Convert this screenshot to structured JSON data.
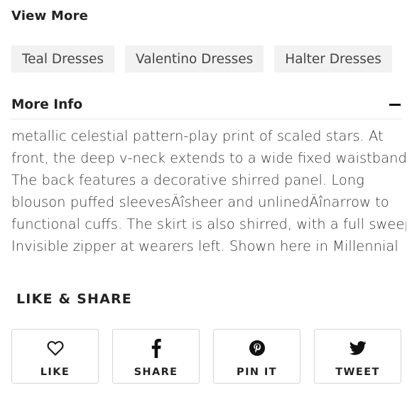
{
  "view_more": {
    "title": "View More",
    "tags": [
      "Teal Dresses",
      "Valentino Dresses",
      "Halter Dresses"
    ]
  },
  "more_info": {
    "title": "More Info",
    "lines": [
      "metallic celestial pattern-play print of scaled stars. At",
      "front, the deep v-neck extends to a wide fixed waistband.",
      "The back features a decorative shirred panel. Long",
      "blouson puffed sleevesÄîsheer and unlinedÄînarrow to",
      "functional cuffs. The skirt is also shirred, with a full sweep.",
      "Invisible zipper at wearers left. Shown here in Millennial"
    ]
  },
  "like_share": {
    "title": "LIKE & SHARE",
    "buttons": [
      {
        "label": "LIKE",
        "icon": "heart-icon"
      },
      {
        "label": "SHARE",
        "icon": "facebook-icon"
      },
      {
        "label": "PIN IT",
        "icon": "pinterest-icon"
      },
      {
        "label": "TWEET",
        "icon": "twitter-icon"
      }
    ]
  }
}
